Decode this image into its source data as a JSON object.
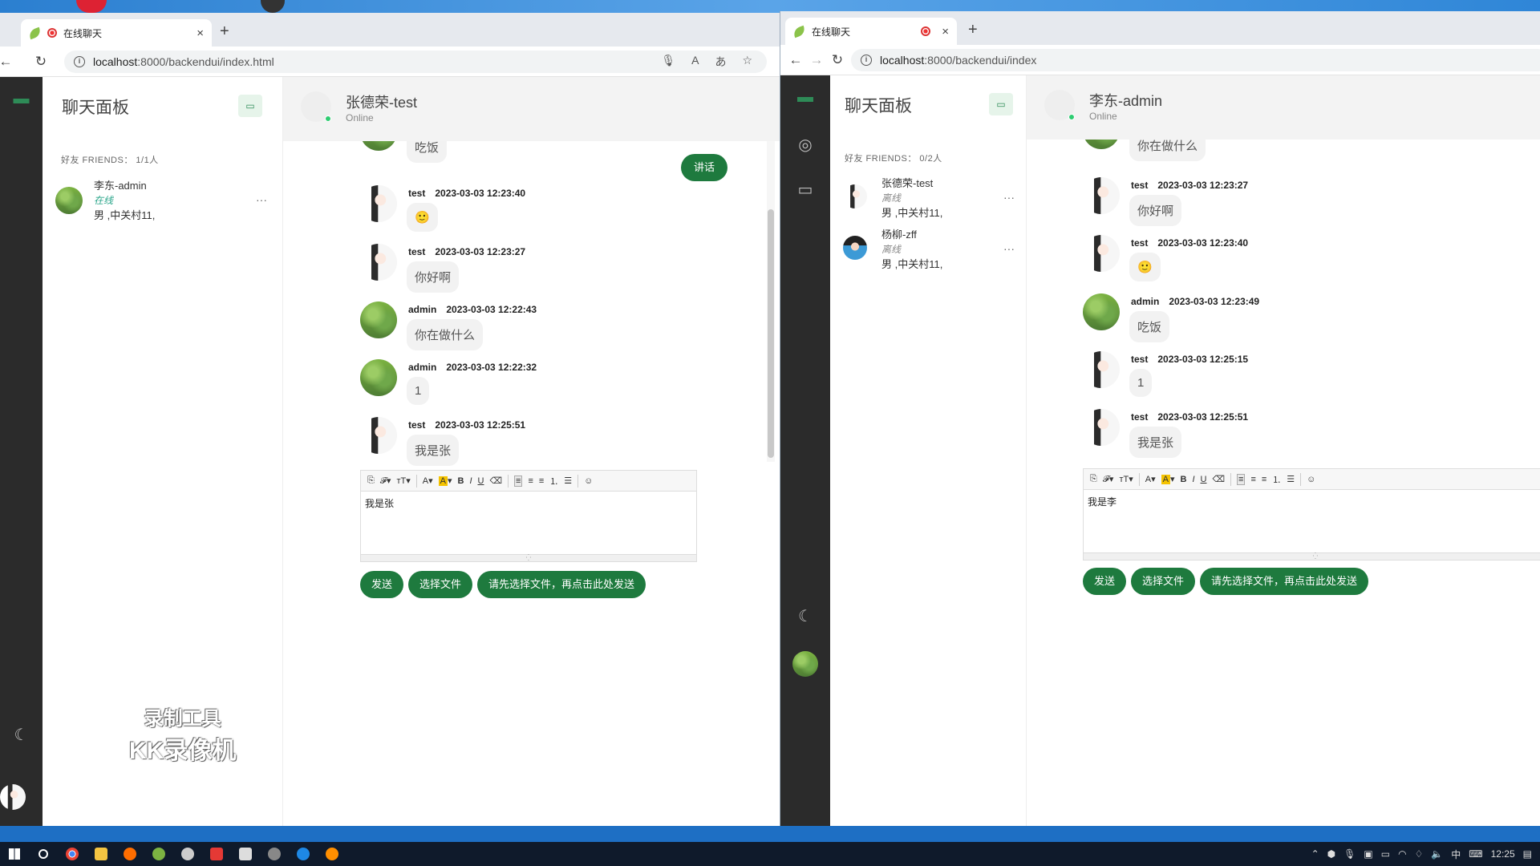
{
  "left_window": {
    "tab_title": "在线聊天",
    "url_host": "localhost",
    "url_path": ":8000/backendui/index.html",
    "panel": {
      "title": "聊天面板",
      "friends_header": "好友 FRIENDS： 1/1人",
      "friends": [
        {
          "name": "李东-admin",
          "status": "在线",
          "address": "男 ,中关村11,",
          "more": "···"
        }
      ]
    },
    "chat": {
      "title": "张德荣-test",
      "subtitle": "Online",
      "speak_button": "讲话",
      "messages": [
        {
          "user": "",
          "time": "",
          "text": "吃饭"
        },
        {
          "user": "test",
          "time": "2023-03-03 12:23:40",
          "text": "🙂"
        },
        {
          "user": "test",
          "time": "2023-03-03 12:23:27",
          "text": "你好啊"
        },
        {
          "user": "admin",
          "time": "2023-03-03 12:22:43",
          "text": "你在做什么"
        },
        {
          "user": "admin",
          "time": "2023-03-03 12:22:32",
          "text": "1"
        },
        {
          "user": "test",
          "time": "2023-03-03 12:25:51",
          "text": "我是张"
        }
      ],
      "editor_text": "我是张",
      "send_button": "发送",
      "choose_file_button": "选择文件",
      "send_file_button": "请先选择文件，再点击此处发送"
    },
    "watermark": {
      "line1": "录制工具",
      "line2": "KK录像机"
    }
  },
  "right_window": {
    "tab_title": "在线聊天",
    "url_host": "localhost",
    "url_path": ":8000/backendui/index",
    "panel": {
      "title": "聊天面板",
      "friends_header": "好友 FRIENDS： 0/2人",
      "friends": [
        {
          "name": "张德荣-test",
          "status": "离线",
          "address": "男 ,中关村11,",
          "more": "···"
        },
        {
          "name": "杨柳-zff",
          "status": "离线",
          "address": "男 ,中关村11,",
          "more": "···"
        }
      ]
    },
    "chat": {
      "title": "李东-admin",
      "subtitle": "Online",
      "messages": [
        {
          "user": "",
          "time": "",
          "text": "你在做什么"
        },
        {
          "user": "test",
          "time": "2023-03-03 12:23:27",
          "text": "你好啊"
        },
        {
          "user": "test",
          "time": "2023-03-03 12:23:40",
          "text": "🙂"
        },
        {
          "user": "admin",
          "time": "2023-03-03 12:23:49",
          "text": "吃饭"
        },
        {
          "user": "test",
          "time": "2023-03-03 12:25:15",
          "text": "1"
        },
        {
          "user": "test",
          "time": "2023-03-03 12:25:51",
          "text": "我是张"
        }
      ],
      "editor_text": "我是李",
      "send_button": "发送",
      "choose_file_button": "选择文件",
      "send_file_button": "请先选择文件，再点击此处发送"
    }
  },
  "toolbar_glyphs": [
    "A",
    "B",
    "I",
    "U"
  ],
  "taskbar": {
    "ime": "中",
    "clock": "12:25"
  },
  "colors": {
    "accent_green": "#1e7a3e",
    "online_green": "#2aa58a",
    "rail": "#2b2b2b"
  }
}
